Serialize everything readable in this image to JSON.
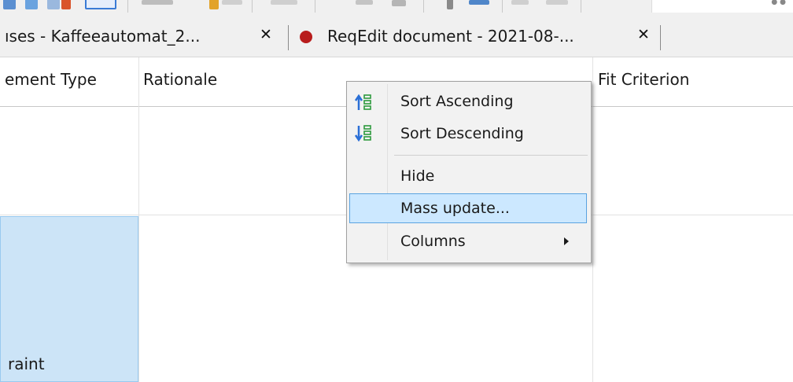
{
  "tabs": [
    {
      "label": "ıses - Kaffeeautomat_2...",
      "close": "✕"
    },
    {
      "label": "ReqEdit document - 2021-08-...",
      "close": "✕",
      "dot_color": "#b81c1c"
    }
  ],
  "table": {
    "columns": [
      "ement Type",
      "Rationale",
      "Fit Criterion"
    ],
    "selected_cell_text": "raint"
  },
  "context_menu": {
    "items": [
      {
        "label": "Sort Ascending",
        "icon": "sort-ascending-icon"
      },
      {
        "label": "Sort Descending",
        "icon": "sort-descending-icon"
      },
      {
        "label": "Hide"
      },
      {
        "label": "Mass update...",
        "highlighted": true
      },
      {
        "label": "Columns",
        "submenu": true
      }
    ]
  },
  "colors": {
    "selection": "#cce4f7",
    "menu_highlight": "#cce8ff",
    "icon_green": "#2e9a3e",
    "icon_blue": "#2a6fd6",
    "tab_dot": "#b81c1c"
  }
}
